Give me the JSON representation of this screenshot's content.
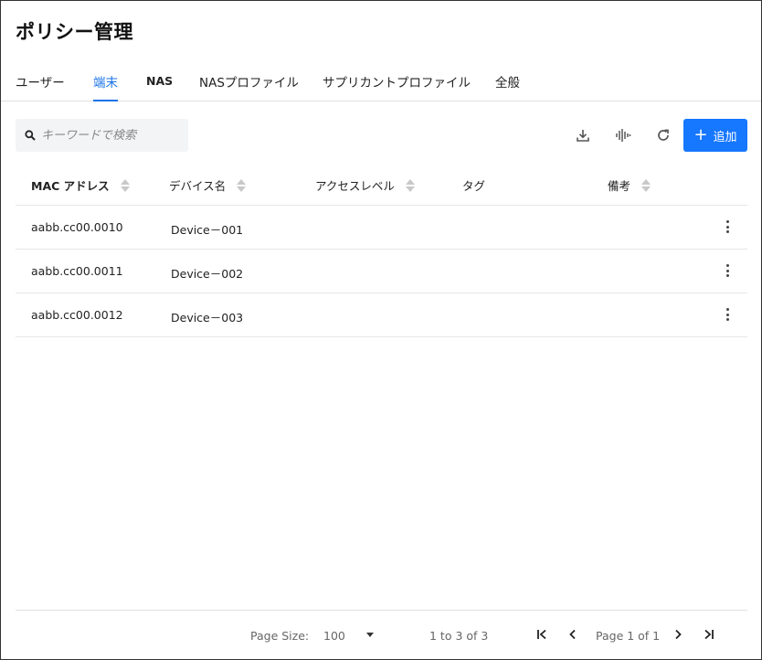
{
  "page": {
    "title": "ポリシー管理"
  },
  "tabs": [
    {
      "label": "ユーザー"
    },
    {
      "label": "端末",
      "active": true
    },
    {
      "label": "NAS"
    },
    {
      "label": "NASプロファイル"
    },
    {
      "label": "サプリカントプロファイル"
    },
    {
      "label": "全般"
    }
  ],
  "toolbar": {
    "search_placeholder": "キーワードで検索",
    "search_icon": "search-icon",
    "download_icon": "download-icon",
    "waveform_icon": "waveform-icon",
    "refresh_icon": "refresh-icon",
    "add_label": "追加",
    "accent_color": "#1677ff"
  },
  "table": {
    "columns": [
      {
        "label": "MAC アドレス"
      },
      {
        "label": "デバイス名"
      },
      {
        "label": "アクセスレベル"
      },
      {
        "label": "タグ"
      },
      {
        "label": "備考"
      }
    ],
    "rows": [
      {
        "mac": "aabb.cc00.0010",
        "device": "Device－001",
        "access": "",
        "tag": "",
        "note": ""
      },
      {
        "mac": "aabb.cc00.0011",
        "device": "Device－002",
        "access": "",
        "tag": "",
        "note": ""
      },
      {
        "mac": "aabb.cc00.0012",
        "device": "Device－003",
        "access": "",
        "tag": "",
        "note": ""
      }
    ]
  },
  "pagination": {
    "page_size_label": "Page Size:",
    "page_size_value": "100",
    "range_text": "1 to 3 of 3",
    "page_text": "Page 1 of 1"
  }
}
